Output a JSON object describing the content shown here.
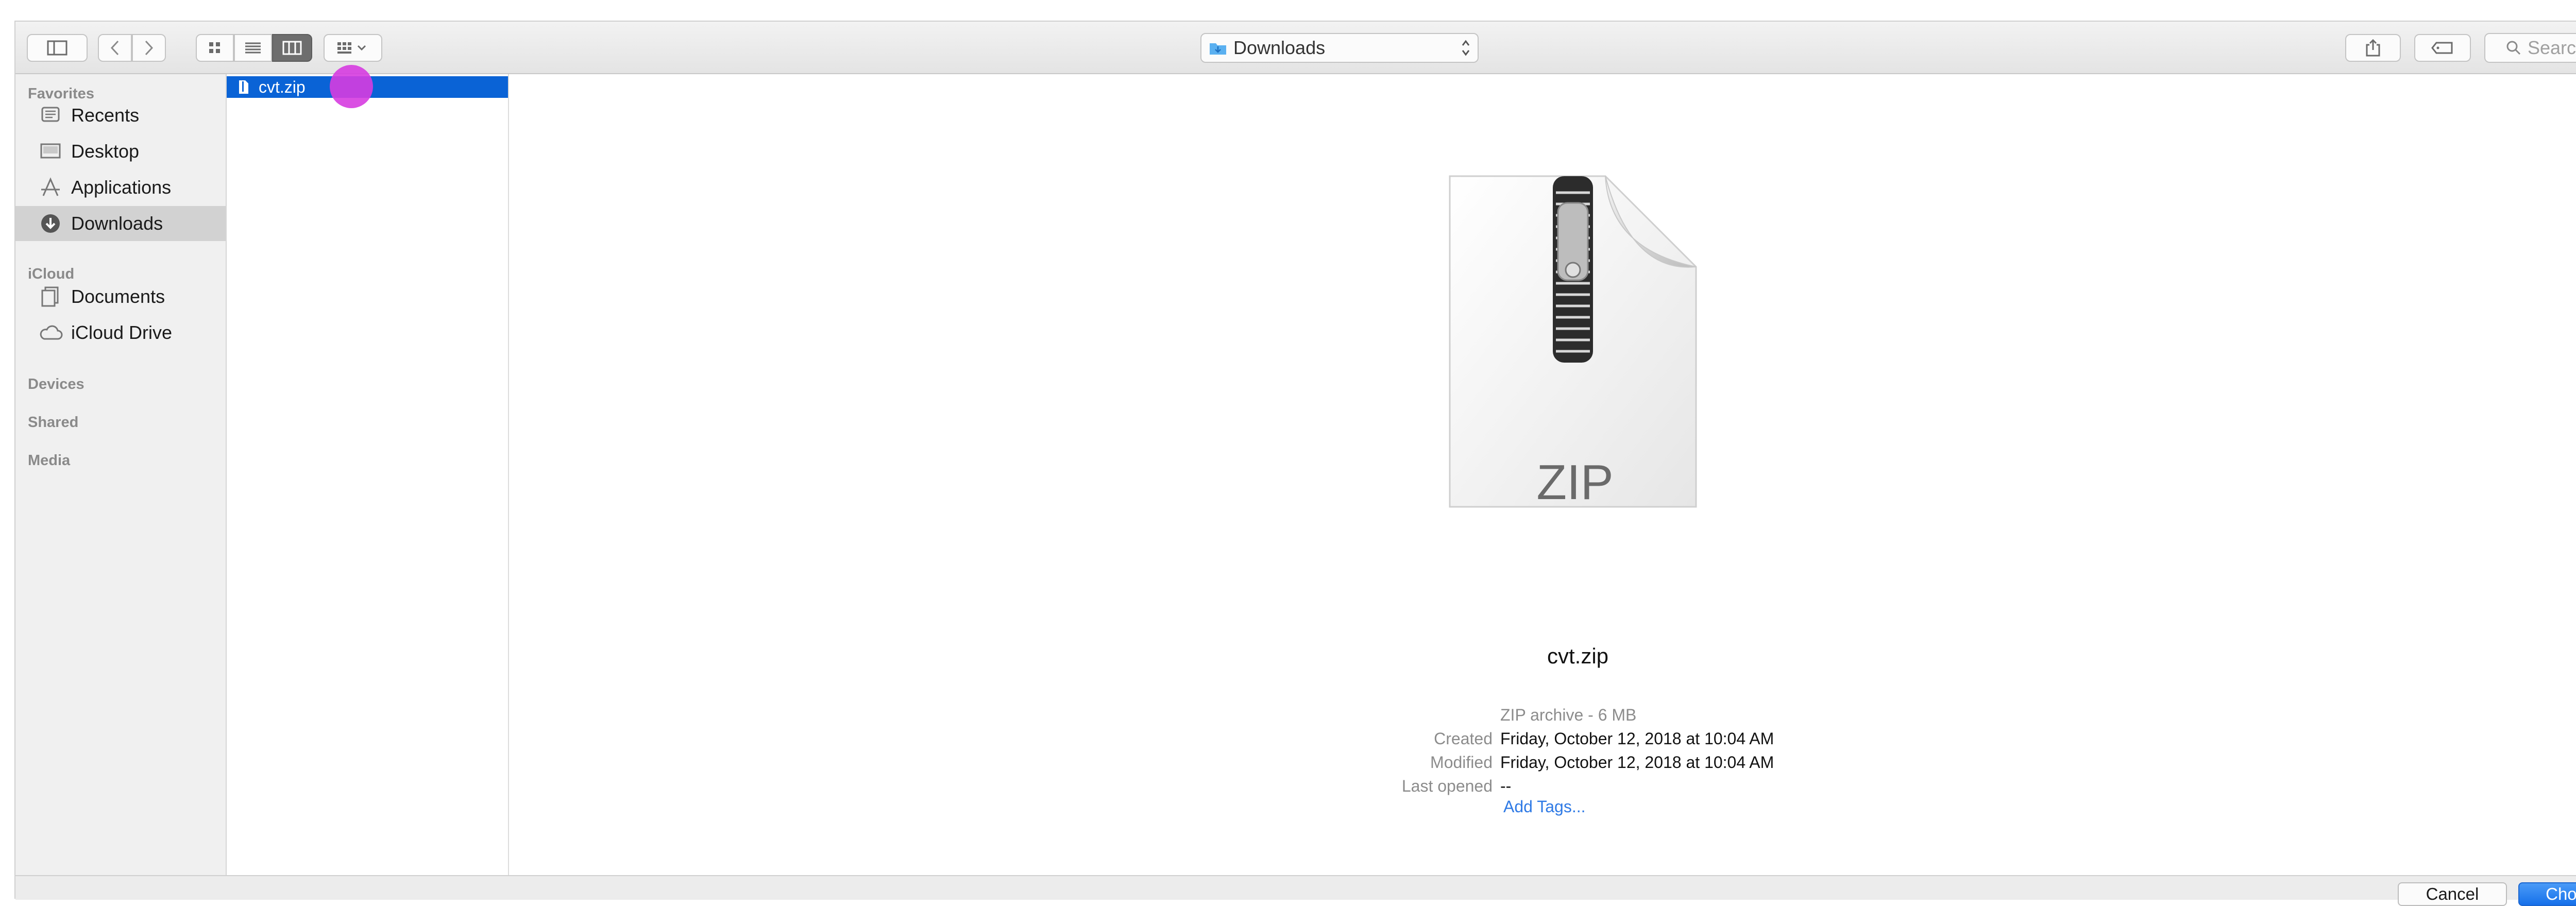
{
  "toolbar": {
    "location": "Downloads",
    "search_placeholder": "Search",
    "icons": [
      "sidebar-toggle-icon",
      "back-icon",
      "forward-icon",
      "icon-view-icon",
      "list-view-icon",
      "column-view-icon",
      "group-icon",
      "share-icon",
      "tag-icon",
      "search-icon"
    ]
  },
  "sidebar": {
    "sections": {
      "favorites": "Favorites",
      "icloud": "iCloud",
      "devices": "Devices",
      "shared": "Shared",
      "media": "Media"
    },
    "favorites": [
      {
        "label": "Recents",
        "icon": "recents-icon"
      },
      {
        "label": "Desktop",
        "icon": "desktop-icon"
      },
      {
        "label": "Applications",
        "icon": "applications-icon"
      },
      {
        "label": "Downloads",
        "icon": "downloads-icon",
        "selected": true
      }
    ],
    "icloud": [
      {
        "label": "Documents",
        "icon": "documents-icon"
      },
      {
        "label": "iCloud Drive",
        "icon": "cloud-icon"
      }
    ]
  },
  "column": {
    "file_name": "cvt.zip"
  },
  "preview": {
    "badge": "ZIP",
    "name": "cvt.zip",
    "kind": "ZIP archive - 6 MB",
    "created_label": "Created",
    "created_value": "Friday, October 12, 2018 at 10:04 AM",
    "modified_label": "Modified",
    "modified_value": "Friday, October 12, 2018 at 10:04 AM",
    "opened_label": "Last opened",
    "opened_value": "--",
    "add_tags": "Add Tags..."
  },
  "buttons": {
    "cancel": "Cancel",
    "choose": "Choose"
  },
  "colors": {
    "selection": "#0a63d6",
    "accent": "#1670ea",
    "cursor": "#d63ce0"
  }
}
